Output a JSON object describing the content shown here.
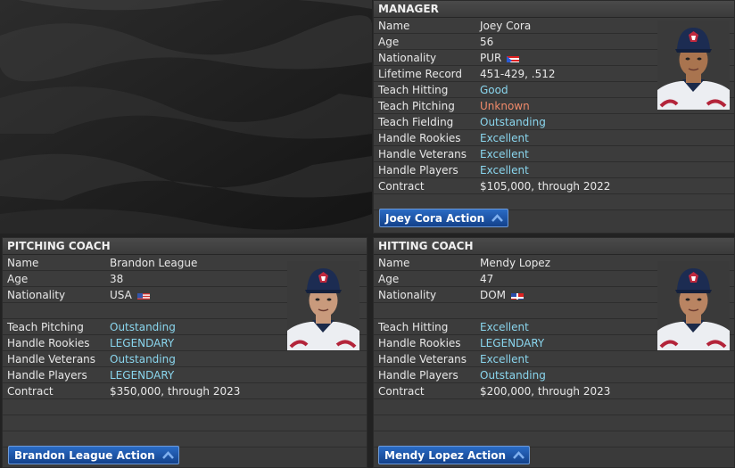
{
  "manager": {
    "header": "MANAGER",
    "rows": [
      {
        "label": "Name",
        "value": "Joey Cora",
        "tone": ""
      },
      {
        "label": "Age",
        "value": "56",
        "tone": ""
      },
      {
        "label": "Nationality",
        "value": "PUR",
        "tone": "",
        "flag": "pur-flag-icon"
      },
      {
        "label": "Lifetime Record",
        "value": "451-429, .512",
        "tone": ""
      },
      {
        "label": "Teach Hitting",
        "value": "Good",
        "tone": "good"
      },
      {
        "label": "Teach Pitching",
        "value": "Unknown",
        "tone": "bad"
      },
      {
        "label": "Teach Fielding",
        "value": "Outstanding",
        "tone": "good"
      },
      {
        "label": "Handle Rookies",
        "value": "Excellent",
        "tone": "good"
      },
      {
        "label": "Handle Veterans",
        "value": "Excellent",
        "tone": "good"
      },
      {
        "label": "Handle Players",
        "value": "Excellent",
        "tone": "good"
      },
      {
        "label": "Contract",
        "value": "$105,000, through 2022",
        "tone": ""
      }
    ],
    "action_label": "Joey Cora Action"
  },
  "pitching_coach": {
    "header": "PITCHING COACH",
    "rows": [
      {
        "label": "Name",
        "value": "Brandon League",
        "tone": ""
      },
      {
        "label": "Age",
        "value": "38",
        "tone": ""
      },
      {
        "label": "Nationality",
        "value": "USA",
        "tone": "",
        "flag": "usa-flag-icon"
      },
      {
        "label": "",
        "value": "",
        "tone": ""
      },
      {
        "label": "Teach Pitching",
        "value": "Outstanding",
        "tone": "good"
      },
      {
        "label": "Handle Rookies",
        "value": "LEGENDARY",
        "tone": "good"
      },
      {
        "label": "Handle Veterans",
        "value": "Outstanding",
        "tone": "good"
      },
      {
        "label": "Handle Players",
        "value": "LEGENDARY",
        "tone": "good"
      },
      {
        "label": "Contract",
        "value": "$350,000, through 2023",
        "tone": ""
      }
    ],
    "action_label": "Brandon League Action"
  },
  "hitting_coach": {
    "header": "HITTING COACH",
    "rows": [
      {
        "label": "Name",
        "value": "Mendy Lopez",
        "tone": ""
      },
      {
        "label": "Age",
        "value": "47",
        "tone": ""
      },
      {
        "label": "Nationality",
        "value": "DOM",
        "tone": "",
        "flag": "dom-flag-icon"
      },
      {
        "label": "",
        "value": "",
        "tone": ""
      },
      {
        "label": "Teach Hitting",
        "value": "Excellent",
        "tone": "good"
      },
      {
        "label": "Handle Rookies",
        "value": "LEGENDARY",
        "tone": "good"
      },
      {
        "label": "Handle Veterans",
        "value": "Excellent",
        "tone": "good"
      },
      {
        "label": "Handle Players",
        "value": "Outstanding",
        "tone": "good"
      },
      {
        "label": "Contract",
        "value": "$200,000, through 2023",
        "tone": ""
      }
    ],
    "action_label": "Mendy Lopez Action"
  },
  "colors": {
    "good": "#8ad6ee",
    "bad": "#f08a6a",
    "button": "#1f5bb0"
  }
}
